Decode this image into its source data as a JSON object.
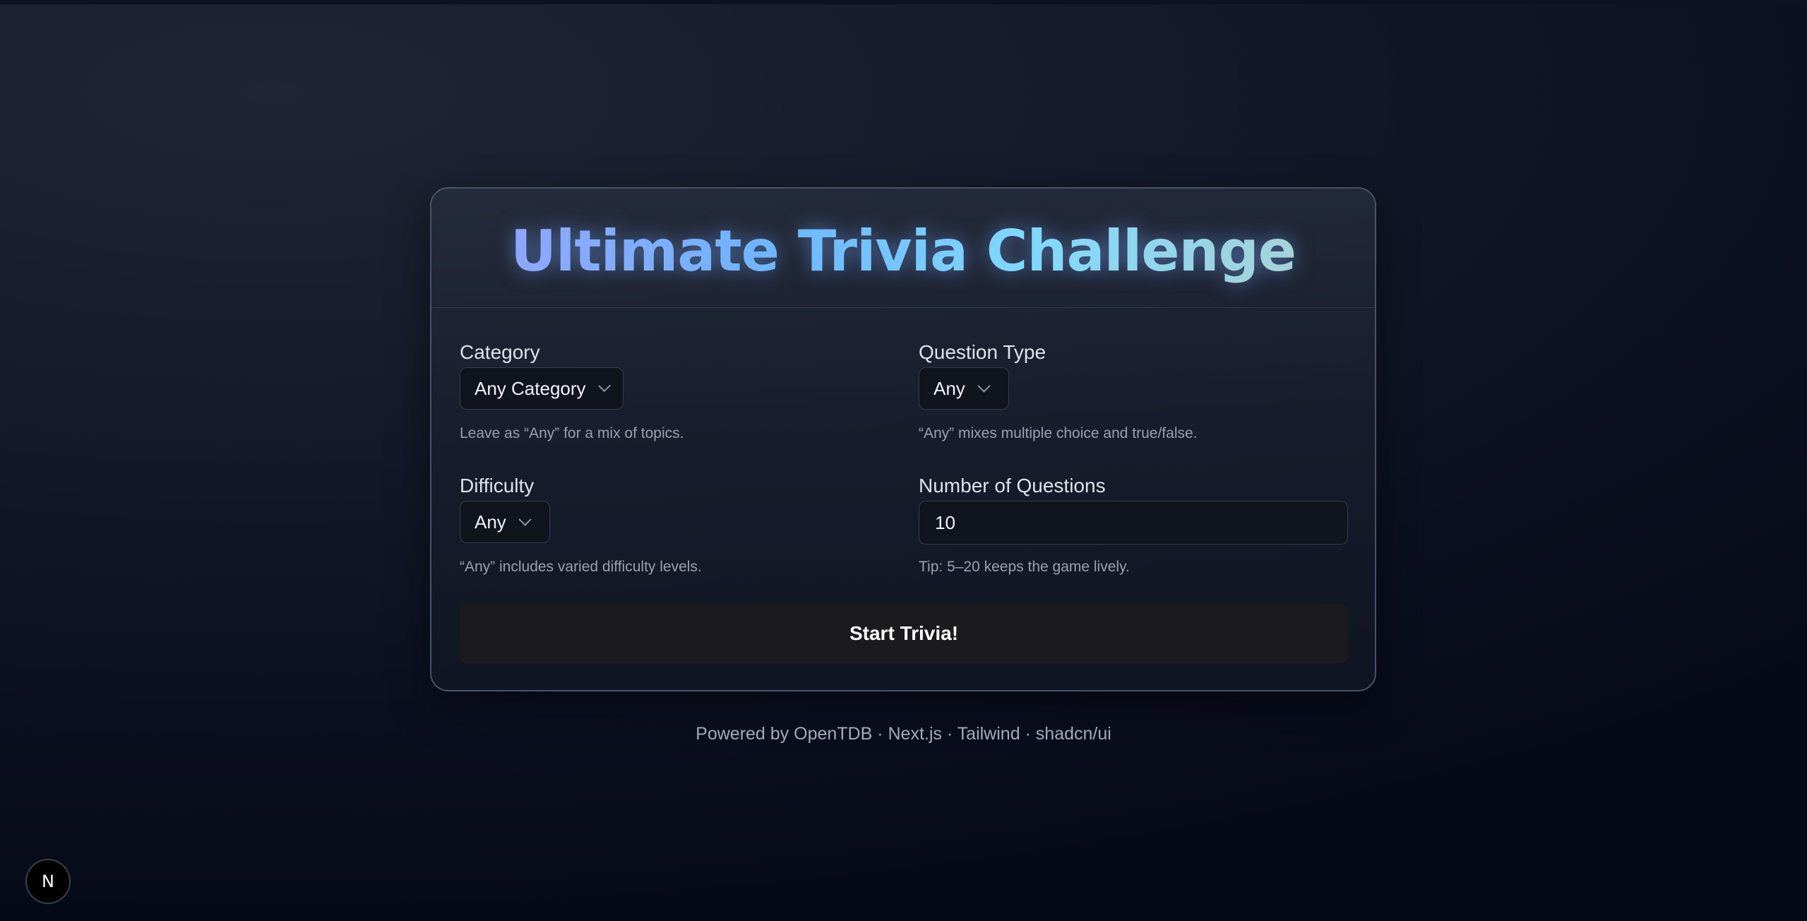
{
  "title": "Ultimate Trivia Challenge",
  "form": {
    "category": {
      "label": "Category",
      "value": "Any Category",
      "help": "Leave as “Any” for a mix of topics."
    },
    "question_type": {
      "label": "Question Type",
      "value": "Any",
      "help": "“Any” mixes multiple choice and true/false."
    },
    "difficulty": {
      "label": "Difficulty",
      "value": "Any",
      "help": "“Any” includes varied difficulty levels."
    },
    "num_questions": {
      "label": "Number of Questions",
      "value": "10",
      "help": "Tip: 5–20 keeps the game lively."
    },
    "start_label": "Start Trivia!"
  },
  "footer": "Powered by OpenTDB · Next.js · Tailwind · shadcn/ui",
  "badge": "N",
  "icons": {
    "select_chevron": "chevron-down-icon",
    "framework_badge": "nextjs-icon"
  },
  "colors": {
    "title_gradient_start": "#8fa6ff",
    "title_gradient_end": "#a6d3d8",
    "button_bg": "#1b1b1d",
    "card_border": "#4a5364"
  }
}
